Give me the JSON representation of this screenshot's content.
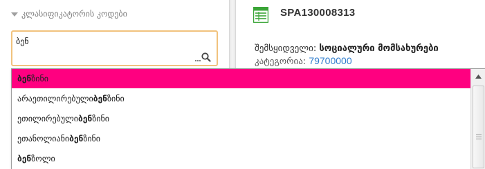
{
  "left_panel": {
    "header": "კლასიფიკატორის კოდები",
    "search_value": "ბენ"
  },
  "right_panel": {
    "doc_code": "SPA130008313",
    "buyer_label": "შემსყიდველი:",
    "buyer_name": "სოციალური მომსახურები",
    "category_label": "კატეგორია:",
    "category_value": "79700000"
  },
  "suggestions": [
    {
      "pre": "",
      "match": "ბენ",
      "post": "ზინი",
      "selected": true
    },
    {
      "pre": "არაეთილირებული ",
      "match": "ბენ",
      "post": "ზინი",
      "selected": false
    },
    {
      "pre": "ეთილირებული ",
      "match": "ბენ",
      "post": "ზინი",
      "selected": false
    },
    {
      "pre": "ეთანოლიანი ",
      "match": "ბენ",
      "post": "ზინი",
      "selected": false
    },
    {
      "pre": "",
      "match": "ბენ",
      "post": "ზოლი",
      "selected": false
    }
  ],
  "colors": {
    "selected_bg": "#ff0080",
    "search_border": "#f1c27d",
    "link": "#2f7ccc",
    "doc_icon": "#3aa537"
  },
  "icons": {
    "header": "collapse-triangle-icon",
    "search": "search-magnifier-icon",
    "document": "spreadsheet-document-icon",
    "scroll_up": "chevron-up-icon"
  }
}
